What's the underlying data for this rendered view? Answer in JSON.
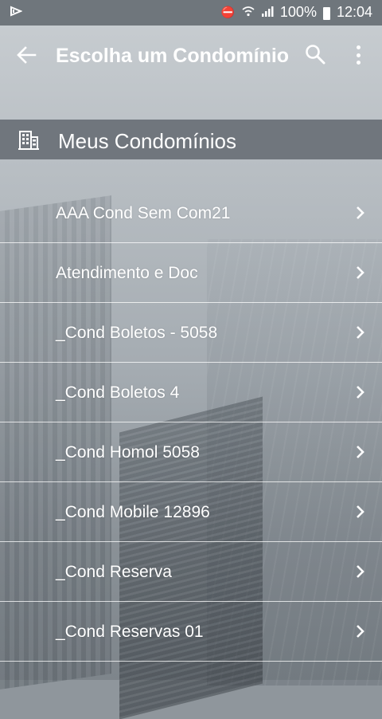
{
  "status_bar": {
    "time": "12:04",
    "battery": "100%",
    "signal_symbols": "⧖ ☷ .▐"
  },
  "toolbar": {
    "title": "Escolha um Condomínio",
    "back_icon": "arrow-left-icon",
    "search_icon": "search-icon",
    "more_icon": "more-vert-icon"
  },
  "section": {
    "icon": "building-icon",
    "label": "Meus Condomínios"
  },
  "condominios": [
    {
      "name": "AAA Cond Sem Com21"
    },
    {
      "name": "Atendimento e Doc"
    },
    {
      "name": "_Cond Boletos - 5058"
    },
    {
      "name": "_Cond Boletos 4"
    },
    {
      "name": "_Cond Homol 5058"
    },
    {
      "name": "_Cond Mobile 12896"
    },
    {
      "name": "_Cond Reserva"
    },
    {
      "name": "_Cond Reservas 01"
    }
  ],
  "colors": {
    "status_bar": "#6f767c",
    "section_header": "#697076",
    "text": "#ffffff"
  }
}
